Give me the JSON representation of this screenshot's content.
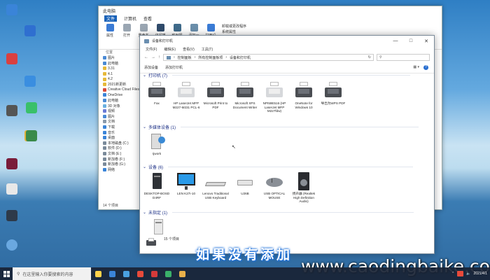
{
  "desktop": {
    "icons": [
      {
        "label": "",
        "color": "#3a84d8"
      },
      {
        "label": "",
        "color": "#2f6fd0"
      },
      {
        "label": "",
        "color": "#d94040"
      },
      {
        "label": "",
        "color": "#3a8ee0"
      },
      {
        "label": "",
        "color": "#555"
      },
      {
        "label": "",
        "color": "#e3b23a"
      },
      {
        "label": "",
        "color": "#7a1d3a"
      }
    ],
    "icons_right": [
      {
        "label": "",
        "color": "#e8e8e8"
      },
      {
        "label": "",
        "color": "#2e3a4a"
      },
      {
        "label": "",
        "color": "#6aa8e0"
      },
      {
        "label": "",
        "color": "#3ac06a"
      },
      {
        "label": "",
        "color": "#3a8a4a"
      }
    ]
  },
  "back_window": {
    "title": "此电脑",
    "tabs": [
      "文件",
      "计算机",
      "查看"
    ],
    "ribbon": [
      {
        "label": "属性",
        "color": "#3a7bd5"
      },
      {
        "label": "打开",
        "color": "#9aa6b2"
      },
      {
        "label": "重命名",
        "color": "#9aa6b2"
      },
      {
        "label": "访问媒体",
        "color": "#2f4a6a"
      },
      {
        "label": "映射网络驱动器",
        "color": "#3f6a8a"
      },
      {
        "label": "添加一个网络位置",
        "color": "#6a8eaa"
      },
      {
        "label": "打开设置",
        "color": "#3a7bd5"
      }
    ],
    "ribbon_right": [
      "卸载或更改程序",
      "系统属性",
      "管理"
    ],
    "group_label": "位置",
    "nav": [
      {
        "label": "图片",
        "color": "#4a8ad5"
      },
      {
        "label": "此电脑",
        "color": "#4a8ad5"
      },
      {
        "label": "3.31",
        "color": "#e6b93a"
      },
      {
        "label": "4.1",
        "color": "#e6b93a"
      },
      {
        "label": "4.2",
        "color": "#e6b93a"
      },
      {
        "label": "2021新更新",
        "color": "#e6b93a"
      },
      {
        "label": "Creative Cloud Files",
        "color": "#d94a3a"
      },
      {
        "label": "OneDrive",
        "color": "#3a84d8"
      },
      {
        "label": "此电脑",
        "color": "#4a8ad5"
      },
      {
        "label": "3D 对象",
        "color": "#6ab0e0"
      },
      {
        "label": "视频",
        "color": "#6a7ad5"
      },
      {
        "label": "图片",
        "color": "#4a8ad5"
      },
      {
        "label": "文档",
        "color": "#8a9aaa"
      },
      {
        "label": "下载",
        "color": "#3a84d8"
      },
      {
        "label": "音乐",
        "color": "#3a84d8"
      },
      {
        "label": "桌面",
        "color": "#3a84d8"
      },
      {
        "label": "本地磁盘 (C:)",
        "color": "#7a8a9a"
      },
      {
        "label": "软件 (D:)",
        "color": "#7a8a9a"
      },
      {
        "label": "文档 (E:)",
        "color": "#7a8a9a"
      },
      {
        "label": "新加卷 (F:)",
        "color": "#7a8a9a"
      },
      {
        "label": "新加卷 (G:)",
        "color": "#7a8a9a"
      },
      {
        "label": "网络",
        "color": "#3a84d8"
      }
    ],
    "status": "14 个项目"
  },
  "window": {
    "title": "设备和打印机",
    "menu": [
      "文件(F)",
      "编辑(E)",
      "查看(V)",
      "工具(T)"
    ],
    "breadcrumb": [
      "控制面板",
      "所有控制面板项",
      "设备和打印机"
    ],
    "search_placeholder": "",
    "commands": [
      "添加设备",
      "添加打印机"
    ],
    "sections": {
      "printers": "打印机 (7)",
      "multimedia": "多媒体设备 (1)",
      "devices": "设备 (6)",
      "unspecified": "未指定 (1)"
    },
    "printers": [
      "Fax",
      "HP LaserJet MFP M227-M231 PCL-6",
      "Microsoft Print to PDF",
      "Microsoft XPS Document Writer",
      "NPI59E516 (HP LaserJet MFP M227fdw)",
      "OneNote for Windows 10",
      "导出为WPS PDF"
    ],
    "multimedia": [
      "Ijwork"
    ],
    "devices": [
      "DESKTOP-BOSD D4RF",
      "LEN K27i-10",
      "Lenovo Traditional USB Keyboard",
      "U26B",
      "USB OPTICAL MOUSE",
      "扬声器 (Realtek High Definition Audio)"
    ],
    "status": "15 个项目"
  },
  "subtitle": "如果没有添加",
  "watermark": "www.caodingbaike.com",
  "taskbar": {
    "search_placeholder": "在这里输入你要搜索的内容",
    "time": "",
    "date": "2021/4/1",
    "apps": [
      {
        "color": "#ffd24a"
      },
      {
        "color": "#3a84d8"
      },
      {
        "color": "#4aa0e0"
      },
      {
        "color": "#e84a3a"
      },
      {
        "color": "#d43a3a"
      },
      {
        "color": "#3ab06a"
      },
      {
        "color": "#e8b04a"
      }
    ]
  }
}
